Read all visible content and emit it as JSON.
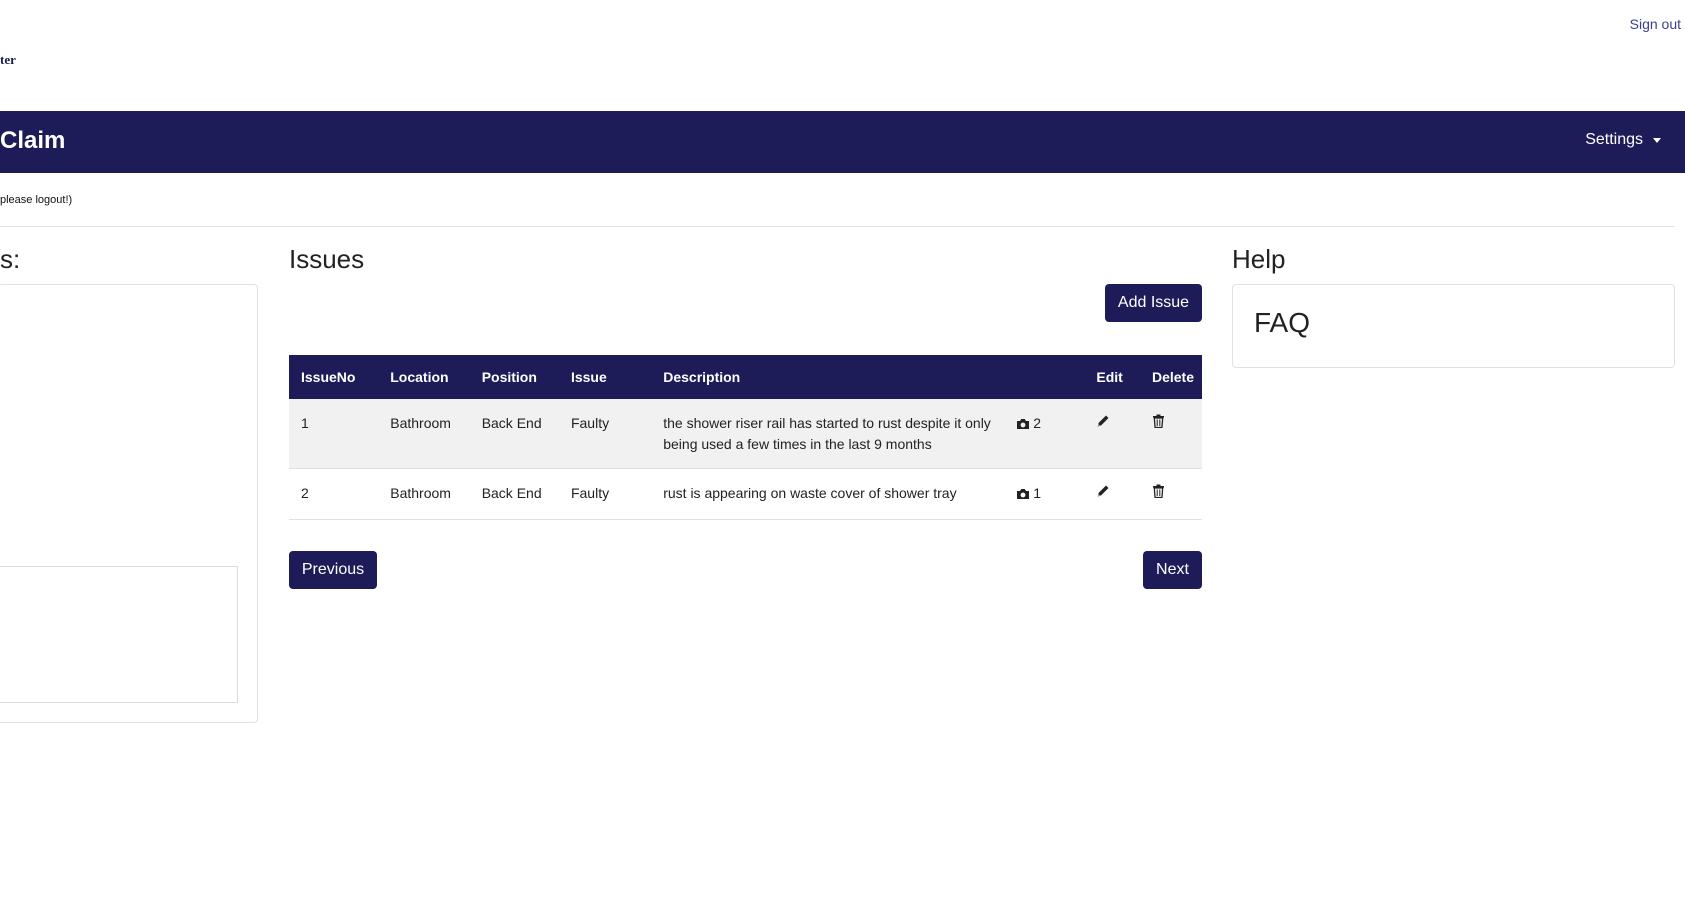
{
  "header": {
    "sign_out": "Sign out",
    "brand_fragment": "ter"
  },
  "navbar": {
    "title": "Claim",
    "settings": "Settings",
    "bg": "#1e1c58"
  },
  "notice": "please logout!)",
  "left_panel": {
    "title": "s:"
  },
  "issues": {
    "title": "Issues",
    "add_label": "Add Issue",
    "columns": [
      "IssueNo",
      "Location",
      "Position",
      "Issue",
      "Description",
      "",
      "Edit",
      "Delete"
    ],
    "rows": [
      {
        "no": "1",
        "location": "Bathroom",
        "position": "Back End",
        "issue": "Faulty",
        "description": "the shower riser rail has started to rust despite it only being used a few times in the last 9 months",
        "photos": "2"
      },
      {
        "no": "2",
        "location": "Bathroom",
        "position": "Back End",
        "issue": "Faulty",
        "description": "rust is appearing on waste cover of shower tray",
        "photos": "1"
      }
    ],
    "previous_label": "Previous",
    "next_label": "Next"
  },
  "help": {
    "title": "Help",
    "faq": "FAQ"
  },
  "icons": {
    "photo": "camera-icon",
    "edit": "pencil-icon",
    "delete": "trash-icon"
  }
}
